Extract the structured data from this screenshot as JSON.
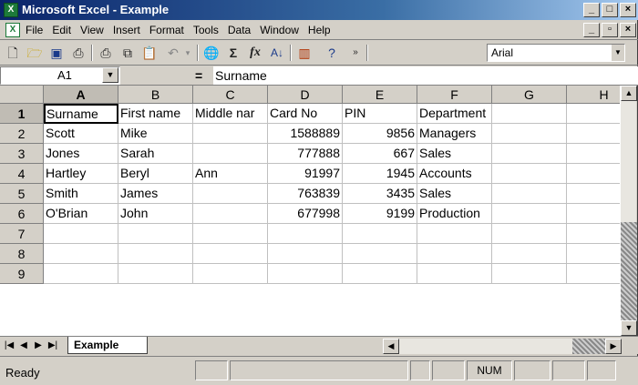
{
  "window": {
    "title": "Microsoft Excel - Example",
    "app_icon": "X",
    "minimize": "_",
    "restore": "□",
    "close": "×"
  },
  "menubar": {
    "items": [
      "File",
      "Edit",
      "View",
      "Insert",
      "Format",
      "Tools",
      "Data",
      "Window",
      "Help"
    ],
    "doc_minimize": "_",
    "doc_restore": "̱",
    "doc_close": "×"
  },
  "toolbar": {
    "icons": [
      "new-icon",
      "open-icon",
      "save-icon",
      "permission-icon",
      "print-icon",
      "copy-icon",
      "paste-icon",
      "undo-icon",
      "hyperlink-icon",
      "autosum-icon",
      "function-icon",
      "sort-ascending-icon",
      "chart-icon",
      "help-icon",
      "more-icon"
    ],
    "font_name": "Arial"
  },
  "formula_bar": {
    "name_box": "A1",
    "equals": "=",
    "value": "Surname"
  },
  "sheet": {
    "columns": [
      "A",
      "B",
      "C",
      "D",
      "E",
      "F",
      "G",
      "H"
    ],
    "rows": [
      {
        "num": "1",
        "cells": [
          "Surname",
          "First name",
          "Middle nar",
          "Card No",
          "PIN",
          "Department",
          "",
          ""
        ]
      },
      {
        "num": "2",
        "cells": [
          "Scott",
          "Mike",
          "",
          "1588889",
          "9856",
          "Managers",
          "",
          ""
        ]
      },
      {
        "num": "3",
        "cells": [
          "Jones",
          "Sarah",
          "",
          "777888",
          "667",
          "Sales",
          "",
          ""
        ]
      },
      {
        "num": "4",
        "cells": [
          "Hartley",
          "Beryl",
          "Ann",
          "91997",
          "1945",
          "Accounts",
          "",
          ""
        ]
      },
      {
        "num": "5",
        "cells": [
          "Smith",
          "James",
          "",
          "763839",
          "3435",
          "Sales",
          "",
          ""
        ]
      },
      {
        "num": "6",
        "cells": [
          "O'Brian",
          "John",
          "",
          "677998",
          "9199",
          "Production",
          "",
          ""
        ]
      },
      {
        "num": "7",
        "cells": [
          "",
          "",
          "",
          "",
          "",
          "",
          "",
          ""
        ]
      },
      {
        "num": "8",
        "cells": [
          "",
          "",
          "",
          "",
          "",
          "",
          "",
          ""
        ]
      },
      {
        "num": "9",
        "cells": [
          "",
          "",
          "",
          "",
          "",
          "",
          "",
          ""
        ]
      }
    ],
    "numeric_columns": [
      3,
      4
    ],
    "active_cell": "A1"
  },
  "tabs": {
    "nav": [
      "|◀",
      "◀",
      "▶",
      "▶|"
    ],
    "active_sheet": "Example"
  },
  "status": {
    "text": "Ready",
    "num_indicator": "NUM"
  }
}
